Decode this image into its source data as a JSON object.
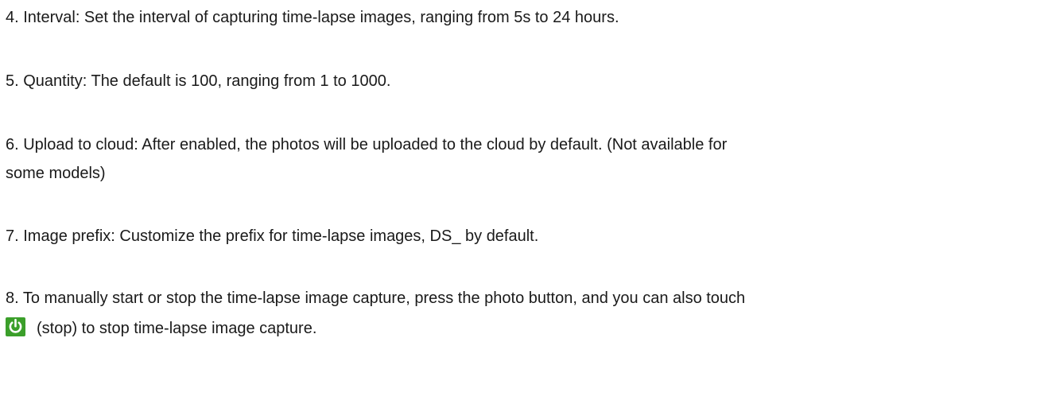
{
  "items": {
    "interval": "4. Interval: Set the interval of capturing time-lapse images, ranging from 5s to 24 hours.",
    "quantity": "5. Quantity: The default is 100, ranging from 1 to 1000.",
    "upload_line1": "6. Upload to cloud: After enabled, the photos will be uploaded to the cloud by default. (Not available for",
    "upload_line2": "some models)",
    "prefix": "7. Image prefix: Customize the prefix for time-lapse images, DS_ by default.",
    "manual_line1": "8. To manually start or stop the time-lapse image capture, press the photo button, and you can also touch",
    "manual_line2": "(stop) to stop time-lapse image capture."
  },
  "icons": {
    "stop": "power-icon"
  },
  "colors": {
    "icon_background": "#3b9f2a",
    "icon_glyph": "#ffffff",
    "text": "#1a1a1a"
  }
}
